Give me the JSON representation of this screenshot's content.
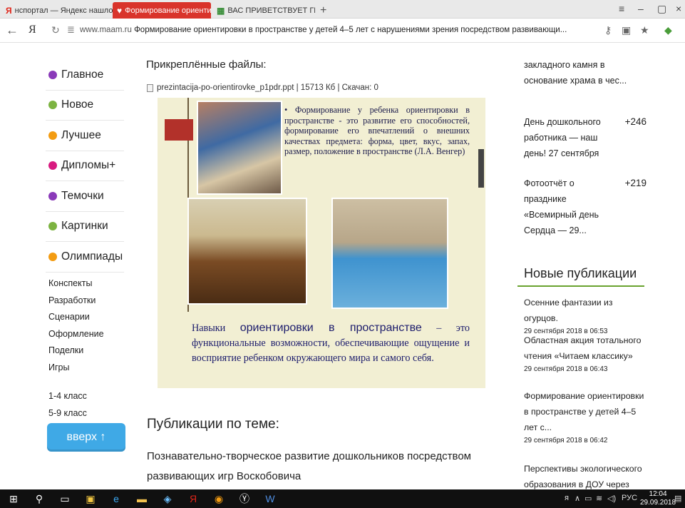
{
  "tabs": [
    {
      "label": "нспортал — Яндекс нашло",
      "icon": "yandex-icon"
    },
    {
      "label": "Формирование ориенти",
      "icon": "heart-icon",
      "active": true
    },
    {
      "label": "ВАС ПРИВЕТСТВУЕТ ГРУПП",
      "icon": "page-icon"
    }
  ],
  "addressbar": {
    "ya": "Я",
    "domain": "www.maam.ru",
    "title": "Формирование ориентировки в пространстве у детей 4–5 лет с нарушениями зрения посредством развивающи..."
  },
  "colors": {
    "active_tab": "#d9342b",
    "up_button": "#3fa9e6",
    "slide_bg": "#f2efd3",
    "accent_underline": "#6aa32f"
  },
  "sidebar": {
    "items": [
      {
        "label": "Главное",
        "color": "#8a3ab9"
      },
      {
        "label": "Новое",
        "color": "#7cb341"
      },
      {
        "label": "Лучшее",
        "color": "#f39c12"
      },
      {
        "label": "Дипломы+",
        "color": "#d81b80"
      },
      {
        "label": "Темочки",
        "color": "#8a3ab9"
      },
      {
        "label": "Картинки",
        "color": "#7cb341"
      },
      {
        "label": "Олимпиады",
        "color": "#f39c12"
      }
    ],
    "links": [
      "Конспекты",
      "Разработки",
      "Сценарии",
      "Оформление",
      "Поделки",
      "Игры"
    ],
    "classes": [
      "1-4 класс",
      "5-9 класс"
    ],
    "up_button": "вверх ↑"
  },
  "main": {
    "attached_title": "Прикреплённые файлы:",
    "file": "prezintacija-po-orientirovke_p1pdr.ppt | 15713 Кб | Скачан: 0",
    "slide": {
      "bullet": "Формирование у ребенка ориентировки в пространстве - это развитие его способностей, формирование его впечатлений о внешних качествах предмета: форма, цвет, вкус, запах, размер, положение в пространстве (Л.А. Венгер)",
      "bottom_pre": "Навыки ",
      "bottom_big": "ориентировки в пространстве",
      "bottom_post": " – это функциональные возможности, обеспечивающие ощущение и восприятие ребенком окружающего мира и самого себя."
    },
    "pub_heading": "Публикации по теме:",
    "pub_item": "Познавательно-творческое развитие дошкольников посредством развивающих игр Воскобовича"
  },
  "right": {
    "fragment": "закладного камня в основание храма в чес...",
    "items": [
      {
        "text": "День дошкольного работника — наш день! 27 сентября",
        "count": "+246"
      },
      {
        "text": "Фотоотчёт о празднике «Всемирный день Сердца — 29...",
        "count": "+219"
      }
    ],
    "new_title": "Новые публикации",
    "new_pubs": [
      {
        "title": "Осенние фантазии из огурцов.",
        "date": "29 сентября 2018 в 06:53"
      },
      {
        "title": "Областная акция тотального чтения «Читаем классику»",
        "date": "29 сентября 2018 в 06:43"
      },
      {
        "title": "Формирование ориентировки в пространстве у детей 4–5 лет с...",
        "date": "29 сентября 2018 в 06:42"
      },
      {
        "title": "Перспективы экологического образования в ДОУ через",
        "date": ""
      }
    ]
  },
  "taskbar": {
    "lang": "РУС",
    "time": "12:04",
    "date": "29.09.2018"
  }
}
